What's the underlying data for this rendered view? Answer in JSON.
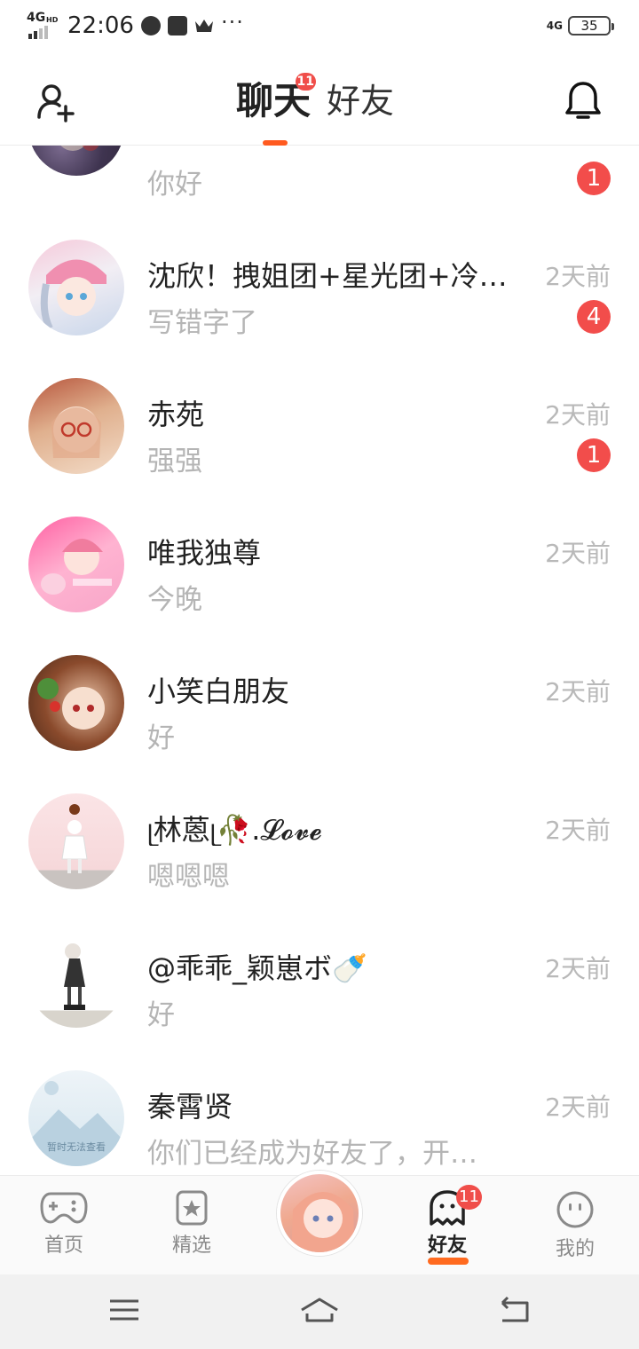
{
  "status_bar": {
    "network": "4G",
    "network_hd": "HD",
    "time": "22:06",
    "more": "···",
    "right_network": "4G",
    "battery": "35"
  },
  "header": {
    "tab_chat": "聊天",
    "tab_chat_badge": "11",
    "tab_friends": "好友",
    "add_friend_icon": "add-user-icon",
    "notification_icon": "bell-icon"
  },
  "chats": [
    {
      "name": "",
      "message": "你好",
      "time": "",
      "unread": "1"
    },
    {
      "name": "沈欣！拽姐团+星光团+冷…",
      "message": "写错字了",
      "time": "2天前",
      "unread": "4"
    },
    {
      "name": "赤苑",
      "message": "强强",
      "time": "2天前",
      "unread": "1"
    },
    {
      "name": "唯我独尊",
      "message": "今晚",
      "time": "2天前",
      "unread": ""
    },
    {
      "name": "小笑白朋友",
      "message": "好",
      "time": "2天前",
      "unread": ""
    },
    {
      "name": "ᥨ林蒽ᥨ🥀.𝓛𝓸𝓿𝓮",
      "message": "嗯嗯嗯",
      "time": "2天前",
      "unread": ""
    },
    {
      "name": "@乖乖_颖崽ボ🍼",
      "message": "好",
      "time": "2天前",
      "unread": ""
    },
    {
      "name": "秦霄贤",
      "message": "你们已经成为好友了，开…",
      "time": "2天前",
      "unread": ""
    }
  ],
  "placeholder_avatar_text": "暂时无法查看",
  "bottom_nav": {
    "home": "首页",
    "featured": "精选",
    "friends": "好友",
    "friends_badge": "11",
    "me": "我的"
  },
  "colors": {
    "accent": "#ff5a1f",
    "badge": "#f24d4b",
    "muted_text": "#b5b5b5"
  }
}
